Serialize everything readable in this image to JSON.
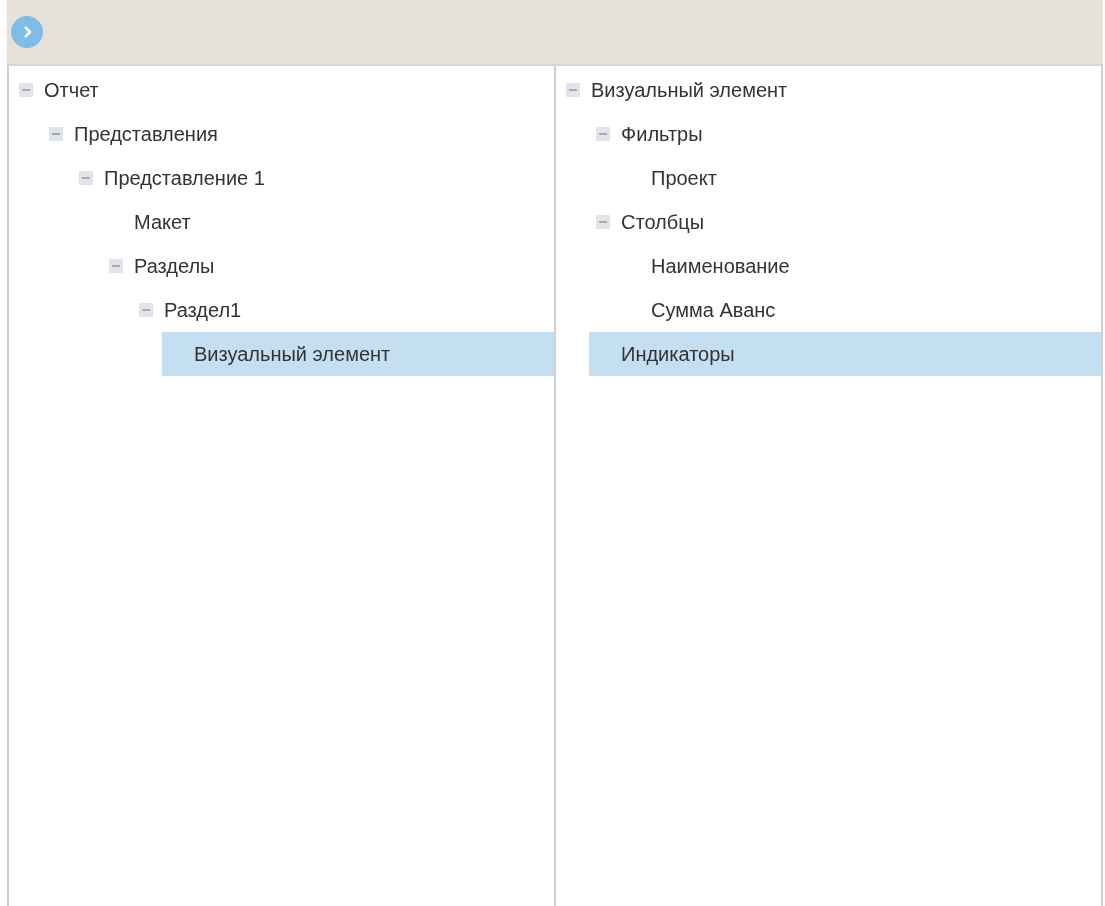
{
  "toolbar": {
    "buttons": [
      {
        "kind": "forward"
      }
    ]
  },
  "panels": [
    {
      "tree": [
        {
          "label": "Отчет",
          "expanded": true,
          "selected": false,
          "children": [
            {
              "label": "Представления",
              "expanded": true,
              "selected": false,
              "children": [
                {
                  "label": "Представление 1",
                  "expanded": true,
                  "selected": false,
                  "children": [
                    {
                      "label": "Макет",
                      "selected": false
                    },
                    {
                      "label": "Разделы",
                      "expanded": true,
                      "selected": false,
                      "children": [
                        {
                          "label": "Раздел1",
                          "expanded": true,
                          "selected": false,
                          "children": [
                            {
                              "label": "Визуальный элемент",
                              "selected": true
                            }
                          ]
                        }
                      ]
                    }
                  ]
                }
              ]
            }
          ]
        }
      ]
    },
    {
      "tree": [
        {
          "label": "Визуальный элемент",
          "expanded": true,
          "selected": false,
          "children": [
            {
              "label": "Фильтры",
              "expanded": true,
              "selected": false,
              "children": [
                {
                  "label": "Проект",
                  "selected": false
                }
              ]
            },
            {
              "label": "Столбцы",
              "expanded": true,
              "selected": false,
              "children": [
                {
                  "label": "Наименование",
                  "selected": false
                },
                {
                  "label": "Сумма Аванс",
                  "selected": false
                }
              ]
            },
            {
              "label": "Индикаторы",
              "selected": true
            }
          ]
        }
      ]
    }
  ]
}
